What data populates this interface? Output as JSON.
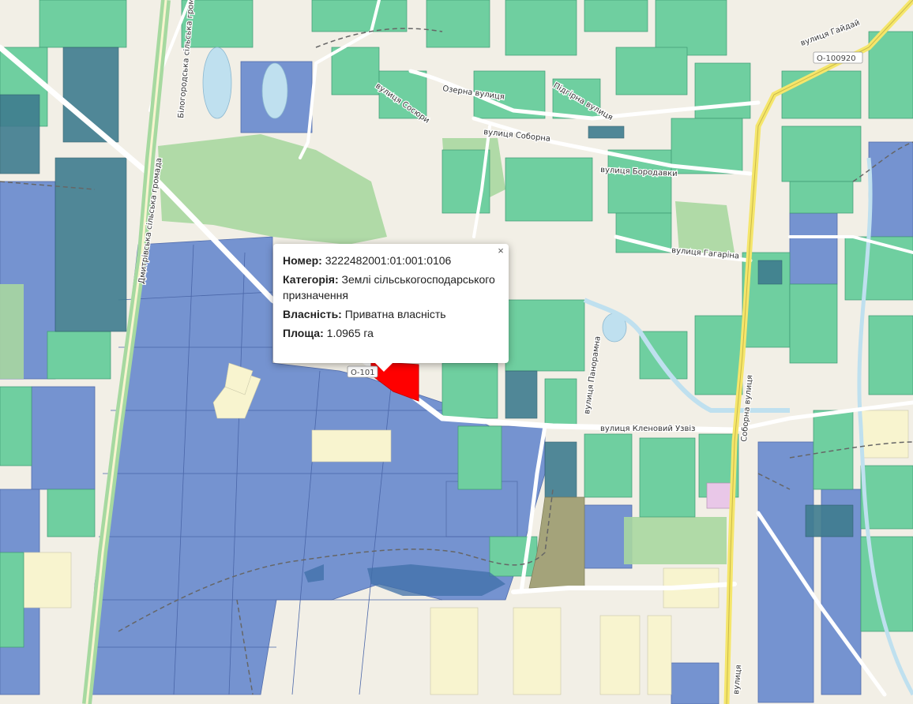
{
  "map": {
    "colors": {
      "background": "#f2efe6",
      "parcel_blue": "#6f8fcf",
      "parcel_green": "#6fcfa0",
      "parcel_dark": "#3f7c8f",
      "forest": "#a8d7a0",
      "water": "#bfe0ef",
      "selected": "#ff0000",
      "road_main": "#f5e66b"
    },
    "streets": [
      {
        "name": "вулиця Гайдай"
      },
      {
        "name": "вулиця Сосюри"
      },
      {
        "name": "Озерна вулиця"
      },
      {
        "name": "Підгірна вулиця"
      },
      {
        "name": "вулиця Соборна"
      },
      {
        "name": "вулиця Бородавки"
      },
      {
        "name": "вулиця Гагаріна"
      },
      {
        "name": "вулиця Кленовий Узвіз"
      },
      {
        "name": "вулиця Панорамна"
      },
      {
        "name": "Соборна вулиця"
      },
      {
        "name": "Білогородська сільська громада"
      },
      {
        "name": "Дмитрівська сільська громада"
      },
      {
        "name": "вулиця"
      }
    ],
    "road_codes": [
      {
        "code": "О-100920"
      },
      {
        "code": "О-101"
      }
    ]
  },
  "popup": {
    "number_label": "Номер:",
    "number_value": "3222482001:01:001:0106",
    "category_label": "Категорія:",
    "category_value": "Землі сільськогосподарського призначення",
    "ownership_label": "Власність:",
    "ownership_value": "Приватна власність",
    "area_label": "Площа:",
    "area_value": "1.0965 га",
    "close_glyph": "×"
  }
}
